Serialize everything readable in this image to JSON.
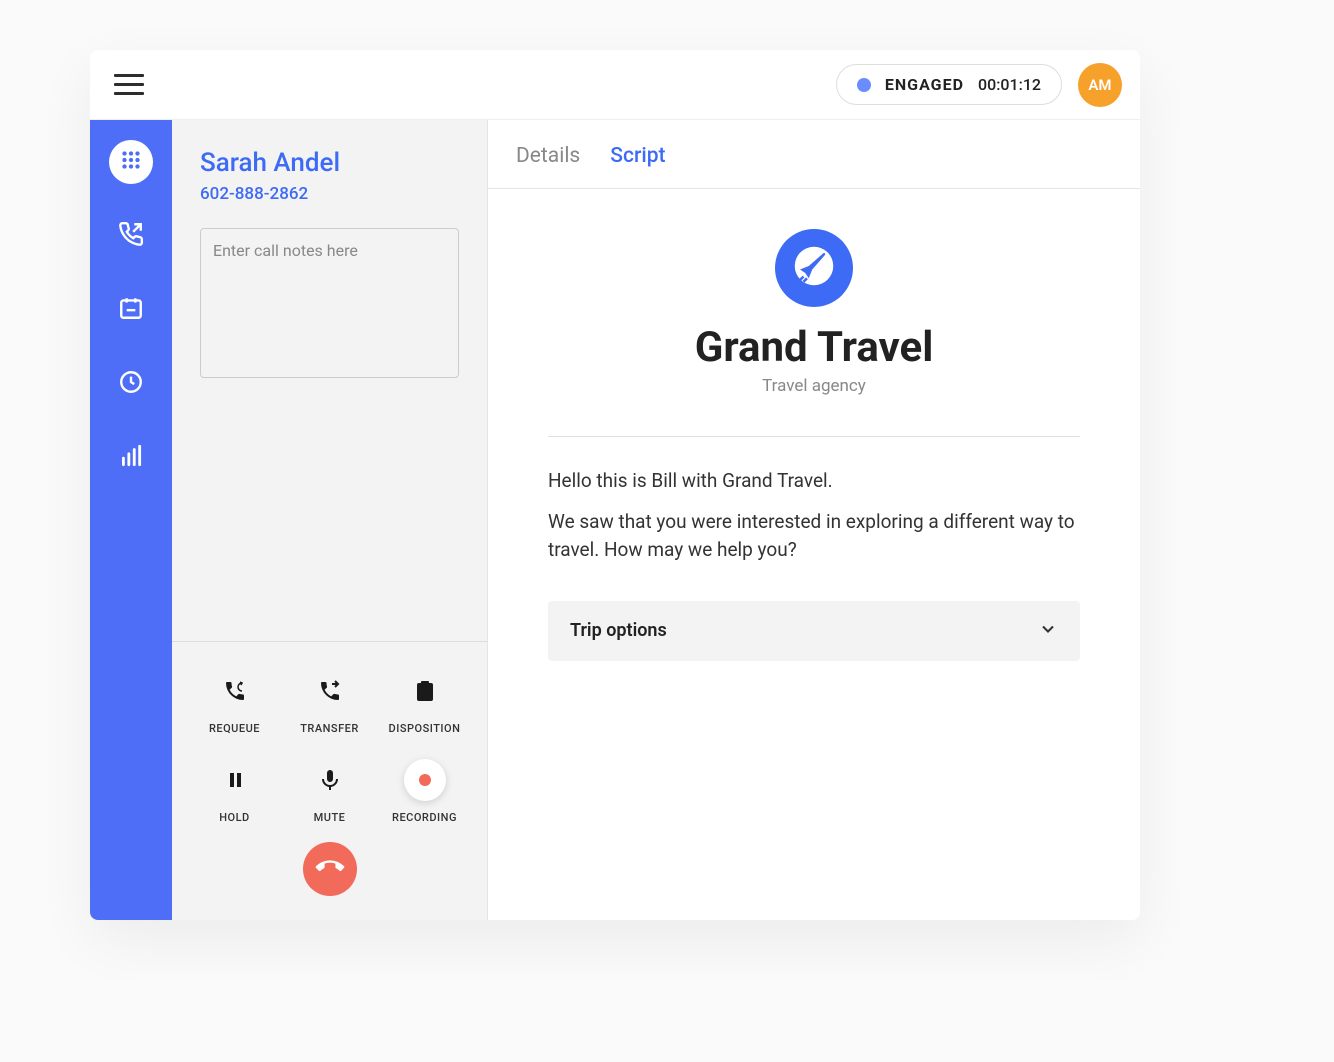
{
  "header": {
    "status_label": "ENGAGED",
    "timer": "00:01:12",
    "avatar_initials": "AM"
  },
  "sidebar": {
    "items": [
      {
        "name": "dialpad"
      },
      {
        "name": "outbound-call"
      },
      {
        "name": "schedule"
      },
      {
        "name": "history"
      },
      {
        "name": "stats"
      }
    ]
  },
  "caller": {
    "name": "Sarah Andel",
    "phone": "602-888-2862",
    "notes_placeholder": "Enter call notes here"
  },
  "controls": {
    "requeue": "REQUEUE",
    "transfer": "TRANSFER",
    "disposition": "DISPOSITION",
    "hold": "HOLD",
    "mute": "MUTE",
    "recording": "RECORDING"
  },
  "tabs": {
    "details": "Details",
    "script": "Script"
  },
  "script": {
    "company_name": "Grand Travel",
    "company_sub": "Travel agency",
    "line1": "Hello this is Bill with Grand Travel.",
    "line2": "We saw that you were interested in exploring a different way to travel. How may we help you?",
    "accordion_title": "Trip options"
  },
  "colors": {
    "brand_blue": "#4f6ef7",
    "link_blue": "#3d6bf5",
    "orange": "#f5a12a",
    "red": "#f26a5a"
  }
}
